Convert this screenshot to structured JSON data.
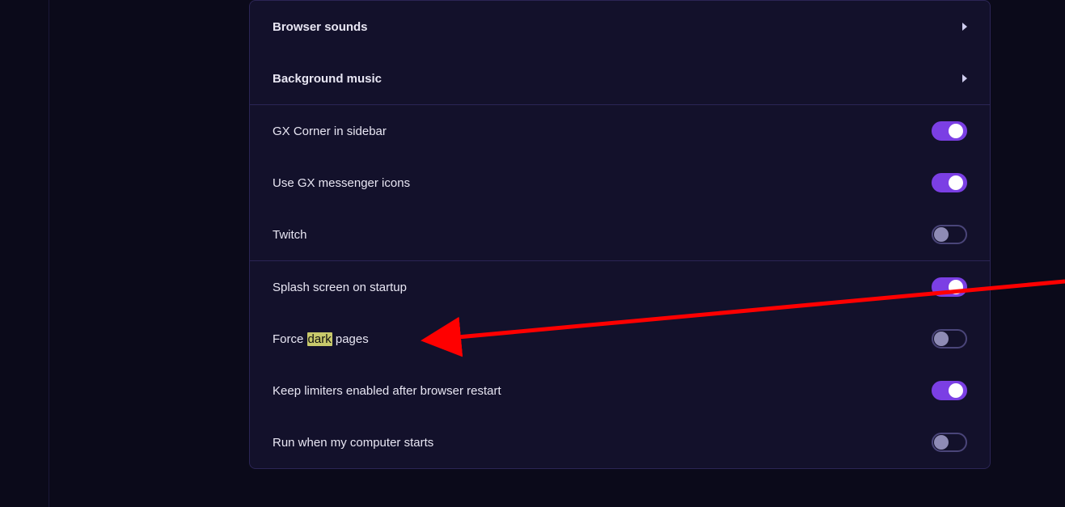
{
  "colors": {
    "accent": "#7b3fe4",
    "panelBg": "#13112b",
    "pageBg": "#0b0a1a",
    "border": "#2b2555",
    "highlight": "#c8c96b",
    "arrow": "#ff0000"
  },
  "headers": {
    "browser_sounds": "Browser sounds",
    "background_music": "Background music"
  },
  "rows": {
    "gx_corner": {
      "label": "GX Corner in sidebar",
      "on": true
    },
    "gx_msg_icons": {
      "label": "Use GX messenger icons",
      "on": true
    },
    "twitch": {
      "label": "Twitch",
      "on": false
    },
    "splash": {
      "label": "Splash screen on startup",
      "on": true
    },
    "force_dark": {
      "pre": "Force ",
      "hl": "dark",
      "post": " pages",
      "on": false
    },
    "keep_limiters": {
      "label": "Keep limiters enabled after browser restart",
      "on": true
    },
    "run_on_start": {
      "label": "Run when my computer starts",
      "on": false
    }
  }
}
